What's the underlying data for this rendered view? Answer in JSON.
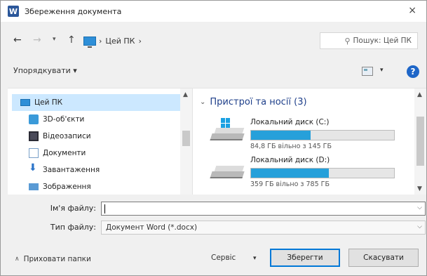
{
  "window": {
    "title": "Збереження документа",
    "app_icon_letter": "W",
    "close_symbol": "×"
  },
  "nav": {
    "back": "←",
    "forward": "→",
    "recent": "▾",
    "up": "↑",
    "address_parts": [
      "›",
      "Цей ПК",
      "›"
    ],
    "search_placeholder": "Пошук: Цей ПК"
  },
  "toolbar": {
    "organize_label": "Упорядкувати ▾",
    "help_label": "?"
  },
  "tree": {
    "items": [
      {
        "label": "Цей ПК",
        "icon": "pc-icon",
        "selected": true
      },
      {
        "label": "3D-об'єкти",
        "icon": "3d-objects-icon"
      },
      {
        "label": "Відеозаписи",
        "icon": "videos-icon"
      },
      {
        "label": "Документи",
        "icon": "documents-icon"
      },
      {
        "label": "Завантаження",
        "icon": "downloads-icon"
      },
      {
        "label": "Зображення",
        "icon": "pictures-icon"
      }
    ]
  },
  "devices": {
    "group_title": "Пристрої та носії (3)",
    "drives": [
      {
        "name": "Локальний диск (C:)",
        "free_text": "84,8 ГБ вільно з 145 ГБ",
        "used_fraction": 0.415
      },
      {
        "name": "Локальний диск (D:)",
        "free_text": "359 ГБ вільно з 785 ГБ",
        "used_fraction": 0.543
      }
    ]
  },
  "form": {
    "filename_label": "Ім'я файлу:",
    "filename_value": "",
    "filetype_label": "Тип файлу:",
    "filetype_value": "Документ Word (*.docx)"
  },
  "footer": {
    "hide_folders_label": "Приховати папки",
    "service_label": "Сервіс",
    "save_label": "Зберегти",
    "cancel_label": "Скасувати"
  },
  "colors": {
    "accent": "#0078d7",
    "drive_bar": "#26a0da",
    "selection": "#cce8ff",
    "group_heading": "#1e3f8a"
  }
}
